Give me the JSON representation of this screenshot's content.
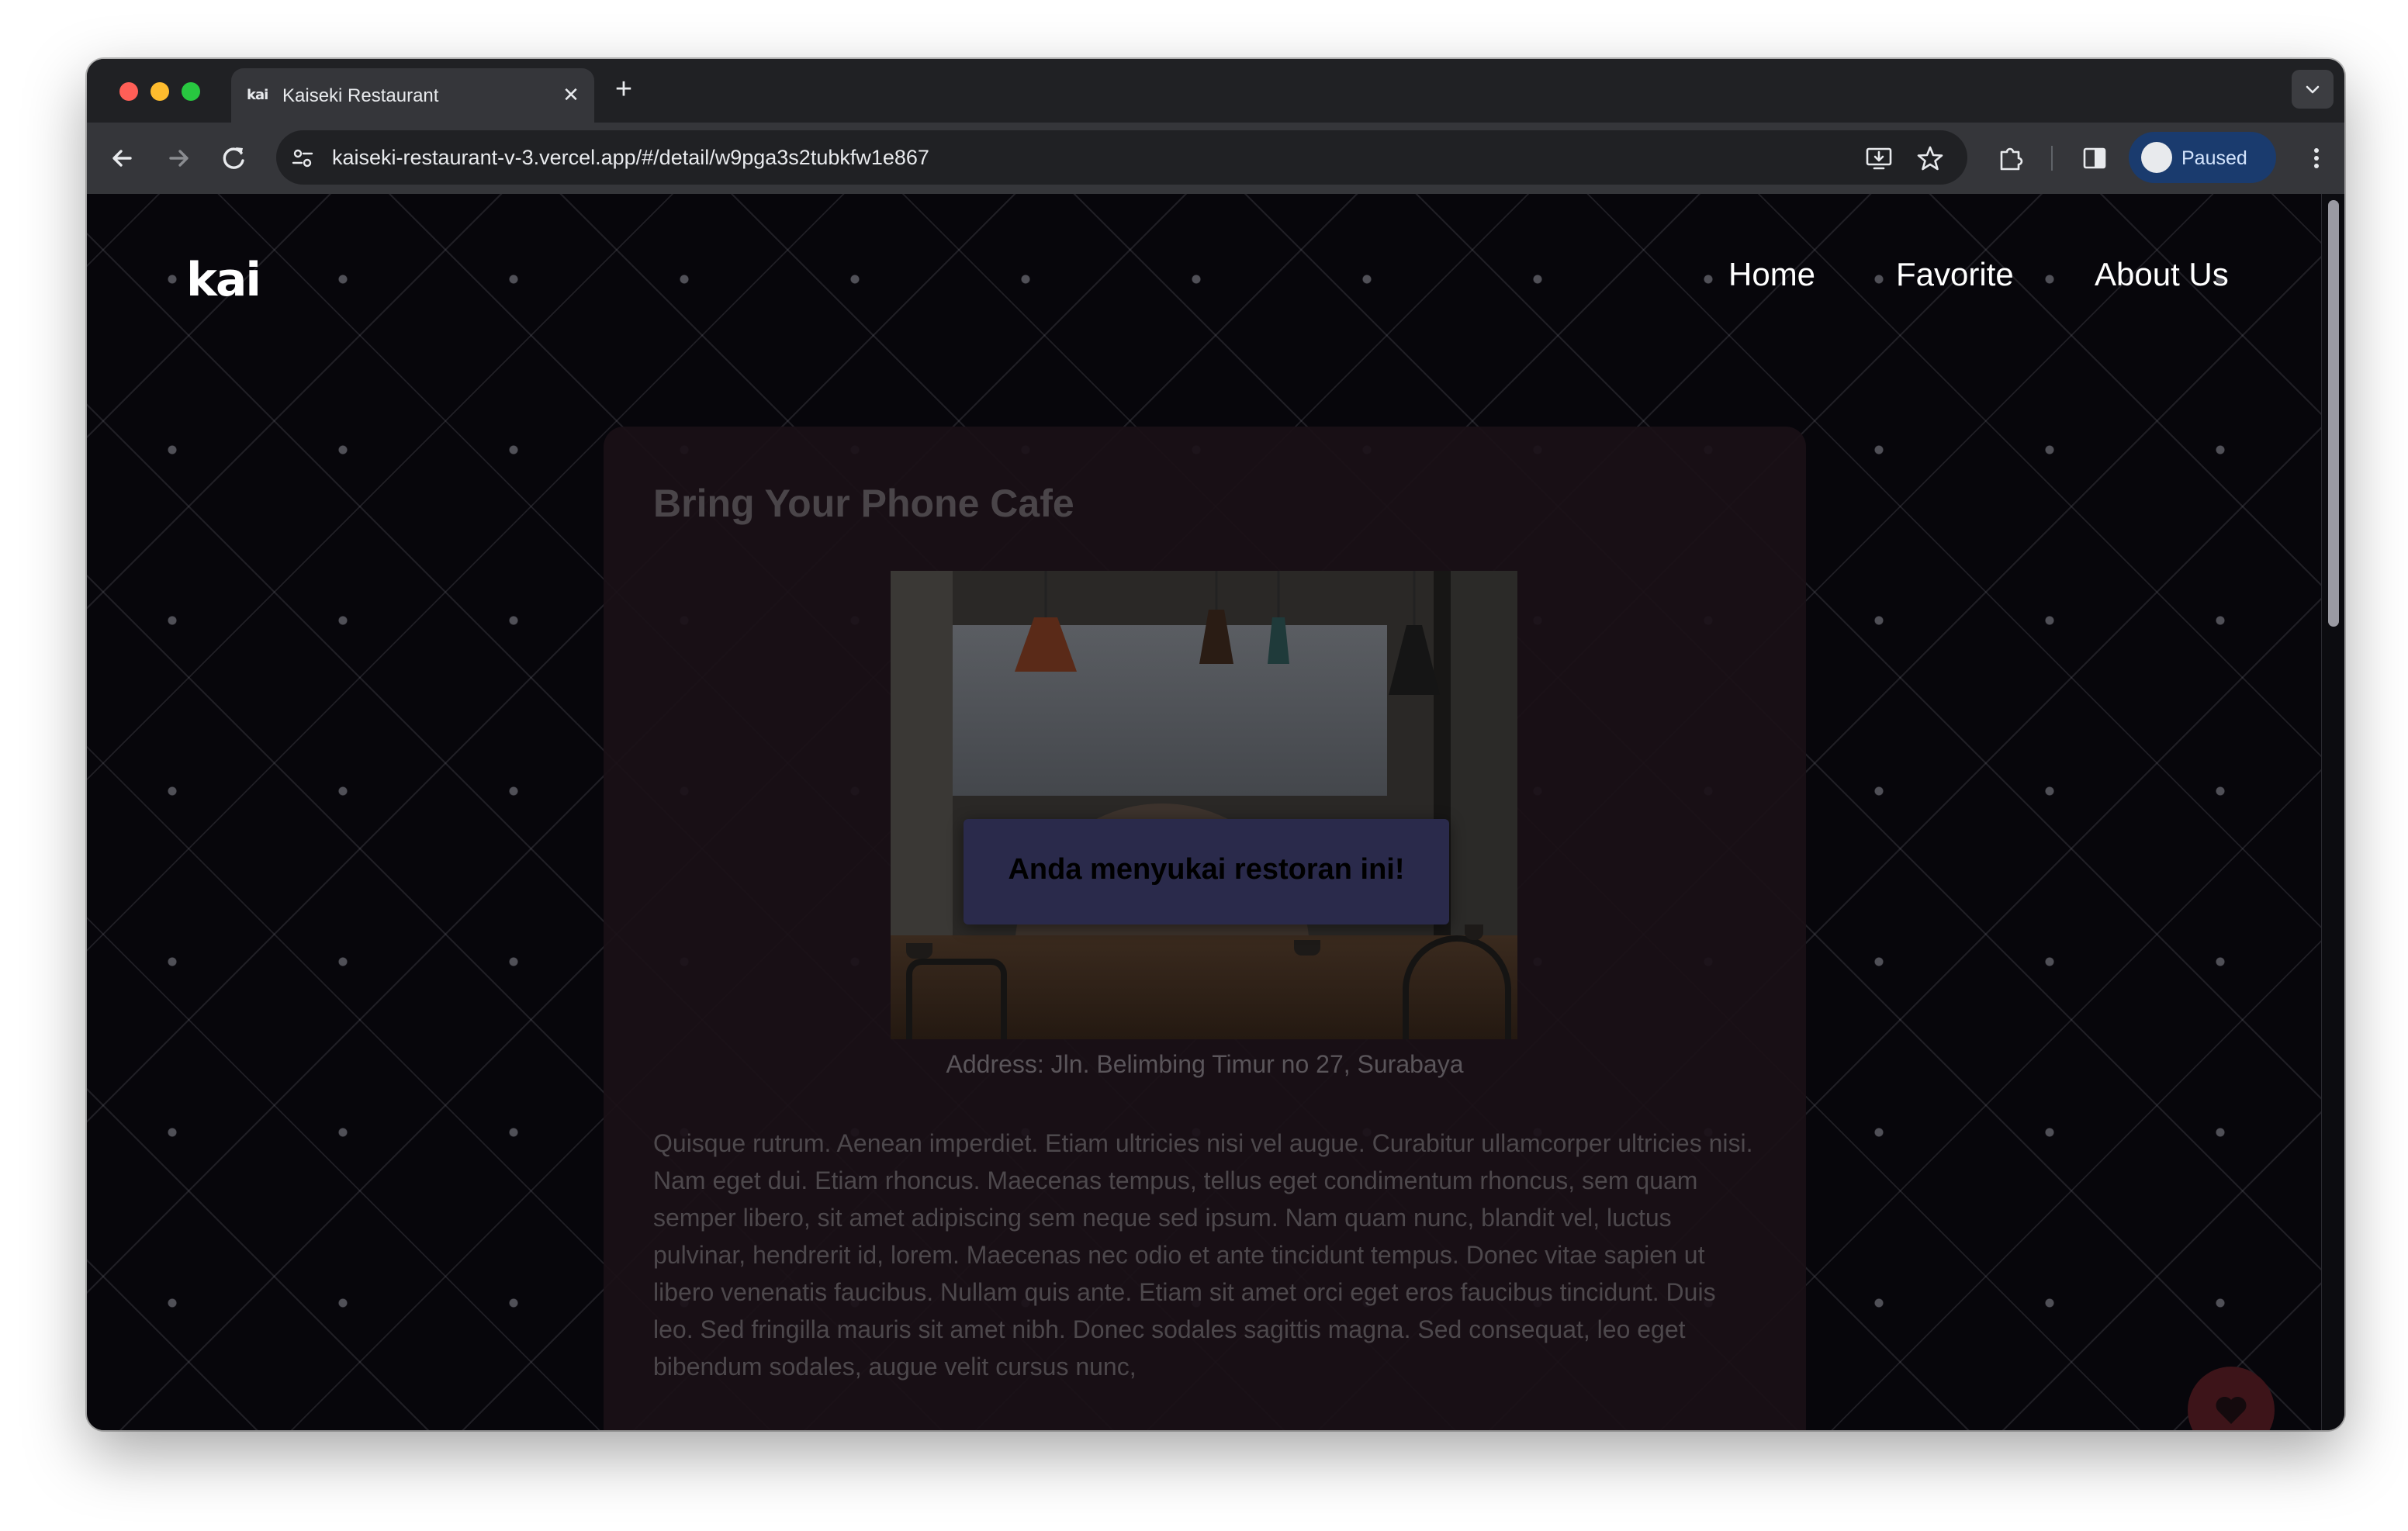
{
  "browser": {
    "tab": {
      "favicon_text": "kai",
      "title": "Kaiseki Restaurant"
    },
    "url": "kaiseki-restaurant-v-3.vercel.app/#/detail/w9pga3s2tubkfw1e867",
    "profile_label": "Paused"
  },
  "site": {
    "logo": "kai",
    "nav": {
      "home": "Home",
      "favorite": "Favorite",
      "about": "About Us"
    }
  },
  "restaurant": {
    "name": "Bring Your Phone Cafe",
    "address": "Address: Jln. Belimbing Timur no 27, Surabaya",
    "description": "Quisque rutrum. Aenean imperdiet. Etiam ultricies nisi vel augue. Curabitur ullamcorper ultricies nisi. Nam eget dui. Etiam rhoncus. Maecenas tempus, tellus eget condimentum rhoncus, sem quam semper libero, sit amet adipiscing sem neque sed ipsum. Nam quam nunc, blandit vel, luctus pulvinar, hendrerit id, lorem. Maecenas nec odio et ante tincidunt tempus. Donec vitae sapien ut libero venenatis faucibus. Nullam quis ante. Etiam sit amet orci eget eros faucibus tincidunt. Duis leo. Sed fringilla mauris sit amet nibh. Donec sodales sagittis magna. Sed consequat, leo eget bibendum sodales, augue velit cursus nunc,"
  },
  "toast": {
    "message": "Anda menyukai restoran ini!"
  },
  "icons": {
    "favorite_button": "heart-icon",
    "back": "arrow-left-icon",
    "forward": "arrow-right-icon",
    "reload": "reload-icon"
  },
  "colors": {
    "page_background": "#07060b",
    "card_background": "#1a1017",
    "toast_background": "#2a2a4b",
    "fab_background": "#3d1419"
  }
}
